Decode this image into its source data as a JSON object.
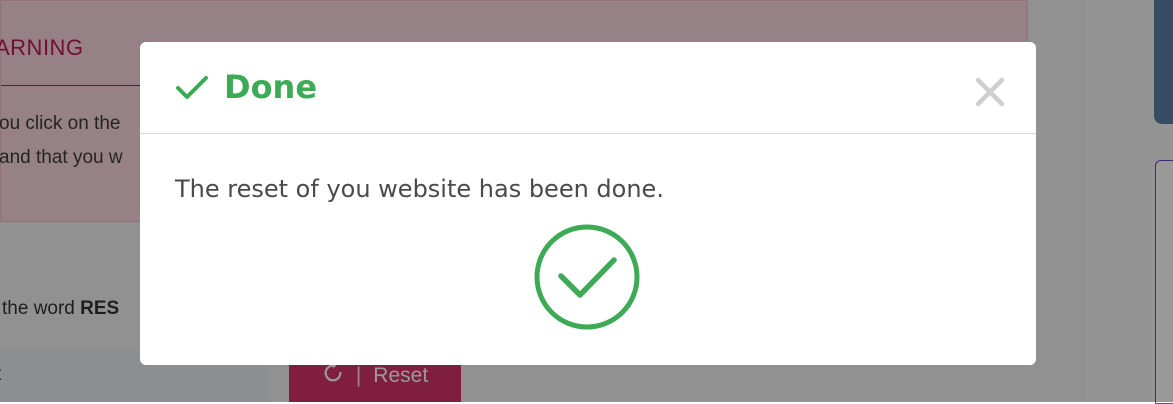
{
  "background": {
    "warning": {
      "title": "ARNING",
      "line1": "ou click on the",
      "line2": "and that you w"
    },
    "instruction": {
      "prefix": "the word ",
      "bold": "RES"
    },
    "input_value": "t",
    "reset_button": {
      "separator": "|",
      "label": "Reset"
    }
  },
  "modal": {
    "title": "Done",
    "message": "The reset of you website has been done.",
    "icons": {
      "header": "checkmark-icon",
      "close": "close-icon",
      "body": "success-circle-check-icon"
    },
    "colors": {
      "success": "#3daa55",
      "close": "#cfcfcf"
    }
  },
  "colors": {
    "warning_text": "#c2185b",
    "reset_button": "#d6336c"
  }
}
